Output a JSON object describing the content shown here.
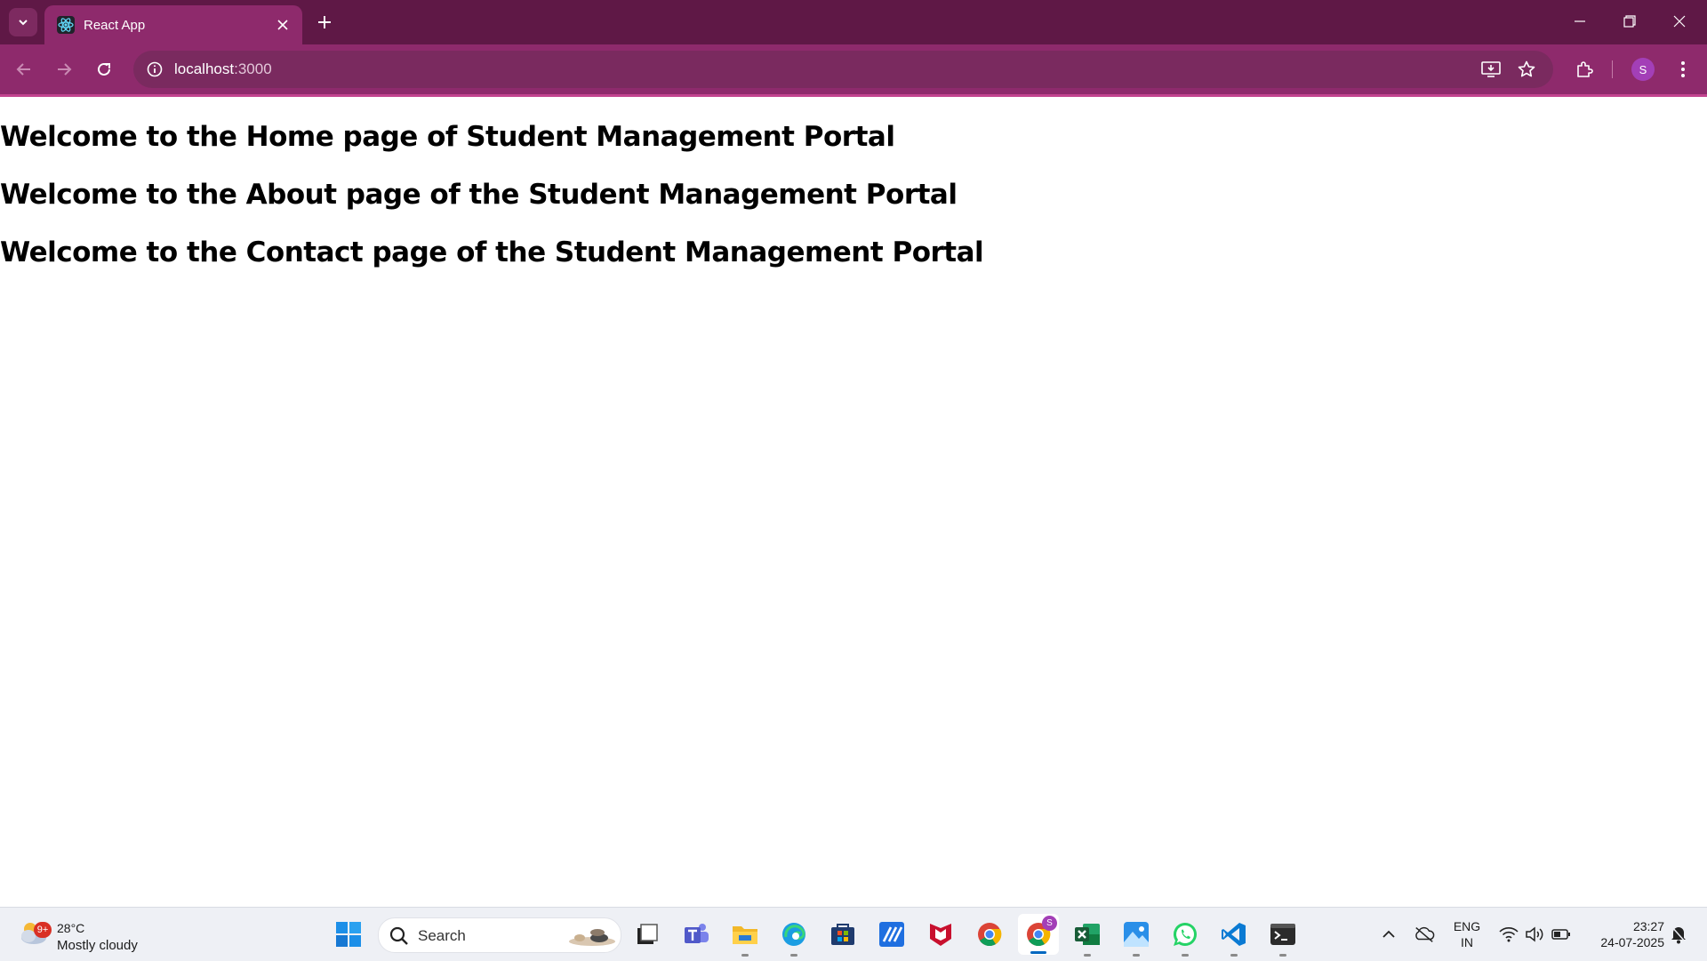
{
  "browser": {
    "tab_title": "React App",
    "url_host": "localhost",
    "url_port": ":3000",
    "profile_initial": "S"
  },
  "page": {
    "headings": [
      "Welcome to the Home page of Student Management Portal",
      "Welcome to the About page of the Student Management Portal",
      "Welcome to the Contact page of the Student Management Portal"
    ]
  },
  "taskbar": {
    "weather_badge": "9+",
    "temperature": "28°C",
    "weather_desc": "Mostly cloudy",
    "search_label": "Search",
    "chrome_badge": "S",
    "language": "ENG",
    "region": "IN",
    "time": "23:27",
    "date": "24-07-2025"
  },
  "colors": {
    "tabstrip": "#5f1846",
    "toolbar": "#8e2a6c",
    "omnibox": "#7a2a5f",
    "profile": "#a33fb7"
  },
  "icons": [
    "tab-search-icon",
    "react-icon",
    "close-icon",
    "plus-icon",
    "minimize-icon",
    "restore-icon",
    "window-close-icon",
    "back-icon",
    "forward-icon",
    "reload-icon",
    "info-icon",
    "install-app-icon",
    "star-icon",
    "extensions-icon",
    "menu-icon",
    "windows-start-icon",
    "search-icon",
    "task-view-icon",
    "teams-icon",
    "file-explorer-icon",
    "edge-icon",
    "store-icon",
    "ms-app-icon",
    "mcafee-icon",
    "chrome-icon",
    "excel-icon",
    "photos-icon",
    "whatsapp-icon",
    "vscode-icon",
    "terminal-icon",
    "chevron-up-icon",
    "onedrive-icon",
    "wifi-icon",
    "volume-icon",
    "battery-icon",
    "notification-icon"
  ]
}
